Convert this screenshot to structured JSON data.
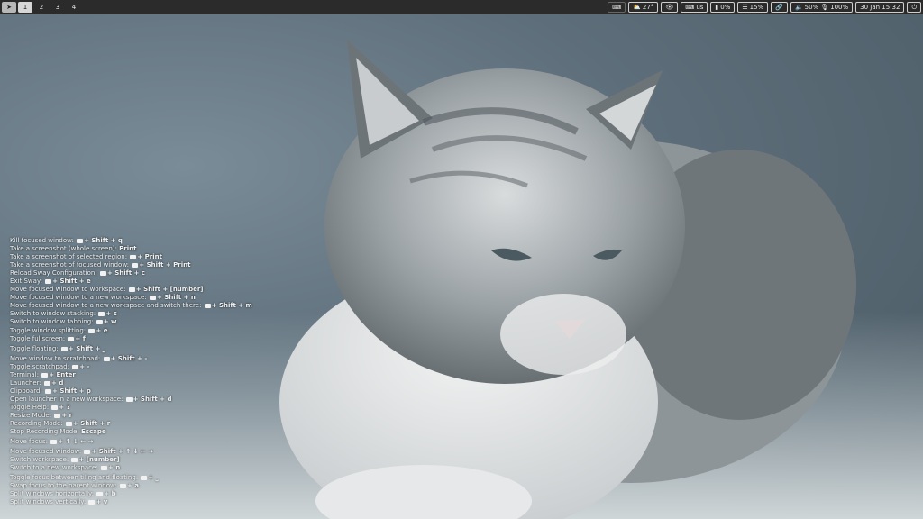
{
  "topbar": {
    "launcher_icon": "send-icon",
    "workspaces": [
      "1",
      "2",
      "3",
      "4"
    ],
    "active_workspace": "1",
    "status": {
      "weather": "27°",
      "keyboard": "us",
      "battery": "0%",
      "cpu": "15%",
      "volume": "50%",
      "brightness": "100%",
      "datetime": "30 Jan 15:32"
    }
  },
  "help": {
    "rows": [
      {
        "label": "Kill focused window:",
        "keys": "+ Shift + q"
      },
      {
        "label": "Take a screenshot (whole screen):",
        "keys": "Print",
        "no_icon": true
      },
      {
        "label": "Take a screenshot of selected region:",
        "keys": "+ Print"
      },
      {
        "label": "Take a screenshot of focused window:",
        "keys": "+ Shift + Print"
      },
      {
        "label": "Reload Sway Configuration:",
        "keys": "+ Shift + c"
      },
      {
        "label": "Exit Sway:",
        "keys": "+ Shift + e"
      },
      {
        "label": "Move focused window to workspace:",
        "keys": "+ Shift + [number]"
      },
      {
        "label": "Move focused window to a new workspace:",
        "keys": "+ Shift + n"
      },
      {
        "label": "Move focused window to a new workspace and switch there:",
        "keys": "+ Shift + m"
      },
      {
        "label": "Switch to window stacking:",
        "keys": "+ s"
      },
      {
        "label": "Switch to window tabbing:",
        "keys": "+ w"
      },
      {
        "label": "Toggle window splitting:",
        "keys": "+ e"
      },
      {
        "label": "Toggle fullscreen:",
        "keys": "+ f"
      },
      {
        "label": "Toggle floating:",
        "keys": "+ Shift + ⎵",
        "gap": true
      },
      {
        "label": "Move window to scratchpad:",
        "keys": "+ Shift + -",
        "gap": true
      },
      {
        "label": "Toggle scratchpad:",
        "keys": "+ -"
      },
      {
        "label": "Terminal:",
        "keys": "+ Enter"
      },
      {
        "label": "Launcher:",
        "keys": "+ d"
      },
      {
        "label": "Clipboard:",
        "keys": "+ Shift + p"
      },
      {
        "label": "Open launcher in a new workspace:",
        "keys": "+ Shift + d"
      },
      {
        "label": "Toggle Help:",
        "keys": "+ ?"
      },
      {
        "label": "Resize Mode:",
        "keys": "+ r"
      },
      {
        "label": "Recording Mode:",
        "keys": "+ Shift + r"
      },
      {
        "label": "Stop Recording Mode:",
        "keys": "Escape",
        "no_icon": true
      },
      {
        "label": "Move focus:",
        "keys": "+ ↑ ↓ ← →",
        "gap": true
      },
      {
        "label": "Move focused window:",
        "keys": "+ Shift + ↑ ↓ ← →",
        "gap": true
      },
      {
        "label": "Switch workspace:",
        "keys": "+ [number]"
      },
      {
        "label": "Switch to a new workspace:",
        "keys": "+ n"
      },
      {
        "label": "Toggle focus between tiling and floating:",
        "keys": "+ ⎵",
        "gap": true
      },
      {
        "label": "Swap focus to the parent window:",
        "keys": "+ a"
      },
      {
        "label": "Split windows horizontally:",
        "keys": "+ b"
      },
      {
        "label": "Split windows vertically:",
        "keys": "+ v"
      }
    ]
  }
}
